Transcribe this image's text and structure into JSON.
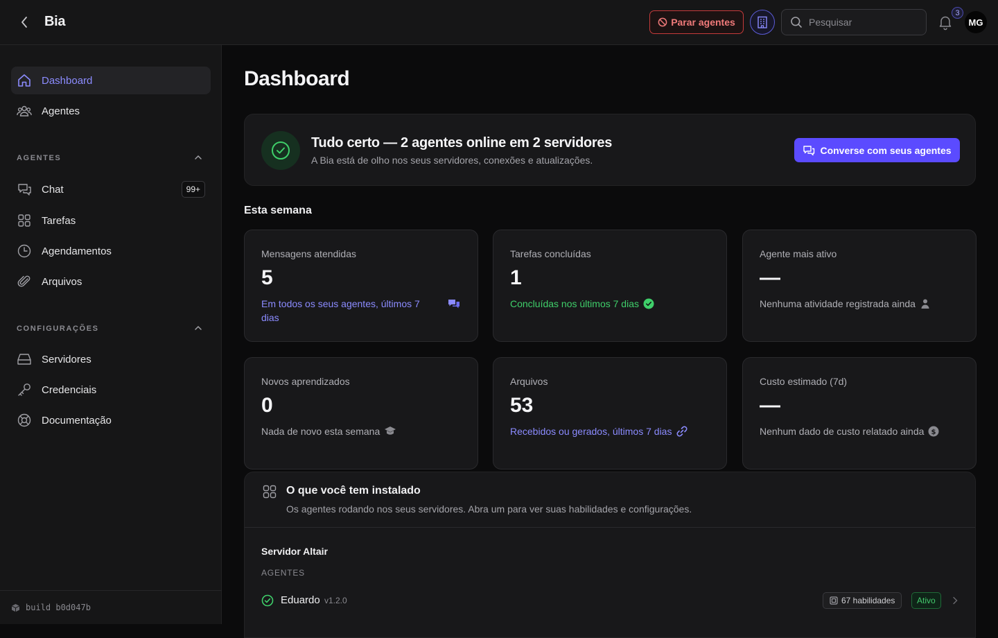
{
  "app": {
    "title": "Bia"
  },
  "header": {
    "stop_label": "Parar agentes",
    "search_placeholder": "Pesquisar",
    "notifications_count": "3",
    "avatar_initials": "MG"
  },
  "sidebar": {
    "top_items": [
      {
        "label": "Dashboard",
        "icon": "home-icon",
        "active": true
      },
      {
        "label": "Agentes",
        "icon": "users-icon",
        "active": false
      }
    ],
    "agents_section": {
      "label": "AGENTES",
      "items": [
        {
          "label": "Chat",
          "icon": "chat-icon",
          "badge": "99+"
        },
        {
          "label": "Tarefas",
          "icon": "grid-icon"
        },
        {
          "label": "Agendamentos",
          "icon": "clock-icon"
        },
        {
          "label": "Arquivos",
          "icon": "paperclip-icon"
        }
      ]
    },
    "settings_section": {
      "label": "CONFIGURAÇÕES",
      "items": [
        {
          "label": "Servidores",
          "icon": "server-icon"
        },
        {
          "label": "Credenciais",
          "icon": "key-icon"
        },
        {
          "label": "Documentação",
          "icon": "lifebuoy-icon"
        }
      ]
    },
    "build": "build b0d047b"
  },
  "main": {
    "title": "Dashboard",
    "status": {
      "title": "Tudo certo — 2 agentes online em 2 servidores",
      "subtitle": "A Bia está de olho nos seus servidores, conexões e atualizações.",
      "button": "Converse com seus agentes"
    },
    "week_label": "Esta semana",
    "stats": [
      {
        "label": "Mensagens atendidas",
        "value": "5",
        "foot": "Em todos os seus agentes, últimos 7 dias",
        "color": "#8b8bff",
        "icon": "messages-icon"
      },
      {
        "label": "Tarefas concluídas",
        "value": "1",
        "foot": "Concluídas nos últimos 7 dias",
        "color": "#3fcf6a",
        "icon": "check-circle-icon"
      },
      {
        "label": "Agente mais ativo",
        "value": "—",
        "foot": "Nenhuma atividade registrada ainda",
        "color": "#b0b0b6",
        "icon": "person-icon"
      },
      {
        "label": "Novos aprendizados",
        "value": "0",
        "foot": "Nada de novo esta semana",
        "color": "#b0b0b6",
        "icon": "graduation-icon"
      },
      {
        "label": "Arquivos",
        "value": "53",
        "foot": "Recebidos ou gerados, últimos 7 dias",
        "color": "#8b8bff",
        "icon": "link-icon"
      },
      {
        "label": "Custo estimado (7d)",
        "value": "—",
        "foot": "Nenhum dado de custo relatado ainda",
        "color": "#b0b0b6",
        "icon": "dollar-icon"
      }
    ],
    "installed": {
      "title": "O que você tem instalado",
      "subtitle": "Os agentes rodando nos seus servidores. Abra um para ver suas habilidades e configurações.",
      "server_name": "Servidor Altair",
      "agents_label": "AGENTES",
      "agents": [
        {
          "name": "Eduardo",
          "version": "v1.2.0",
          "skills": "67 habilidades",
          "status": "Ativo"
        }
      ]
    }
  }
}
